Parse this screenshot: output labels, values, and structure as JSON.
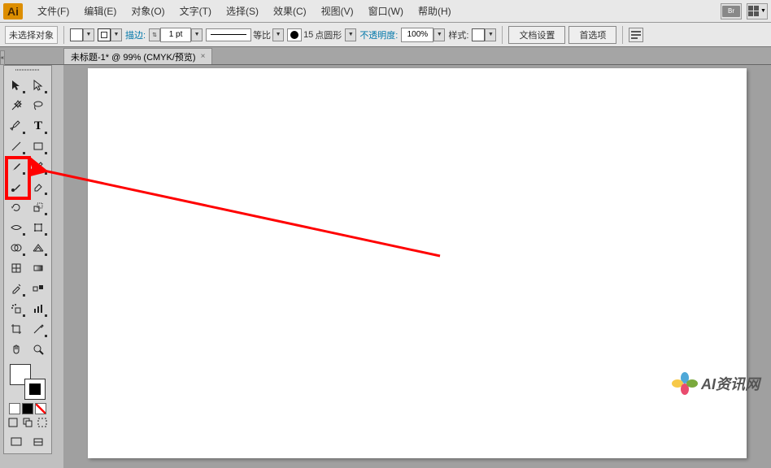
{
  "logo": "Ai",
  "menu": {
    "file": "文件(F)",
    "edit": "编辑(E)",
    "object": "对象(O)",
    "type": "文字(T)",
    "select": "选择(S)",
    "effect": "效果(C)",
    "view": "视图(V)",
    "window": "窗口(W)",
    "help": "帮助(H)"
  },
  "menubar_right": {
    "br": "Br"
  },
  "options": {
    "selection": "未选择对象",
    "stroke_label": "描边:",
    "stroke_value": "1 pt",
    "uniform": "等比",
    "brush_size": "15",
    "brush_name": "点圆形",
    "opacity_label": "不透明度:",
    "opacity_value": "100%",
    "style_label": "样式:",
    "doc_setup": "文档设置",
    "prefs": "首选项"
  },
  "tab": {
    "title": "未标题-1* @ 99% (CMYK/预览)"
  },
  "watermark": {
    "text": "AI资讯网"
  },
  "tools": {
    "selection": "selection-tool",
    "direct": "direct-selection-tool",
    "wand": "magic-wand-tool",
    "lasso": "lasso-tool",
    "pen": "pen-tool",
    "type": "type-tool",
    "line": "line-tool",
    "rect": "rectangle-tool",
    "brush": "paintbrush-tool",
    "pencil": "pencil-tool",
    "blob": "blob-brush-tool",
    "eraser": "eraser-tool",
    "rotate": "rotate-tool",
    "reflect": "reflect-tool",
    "scale": "scale-tool",
    "width": "width-tool",
    "warp": "free-transform-tool",
    "shapebuilder": "shape-builder-tool",
    "perspective": "perspective-grid-tool",
    "mesh": "mesh-tool",
    "gradient": "gradient-tool",
    "eyedrop": "eyedropper-tool",
    "blend": "blend-tool",
    "symbol": "symbol-sprayer-tool",
    "graph": "column-graph-tool",
    "artboard": "artboard-tool",
    "slice": "slice-tool",
    "hand": "hand-tool",
    "zoom": "zoom-tool"
  }
}
